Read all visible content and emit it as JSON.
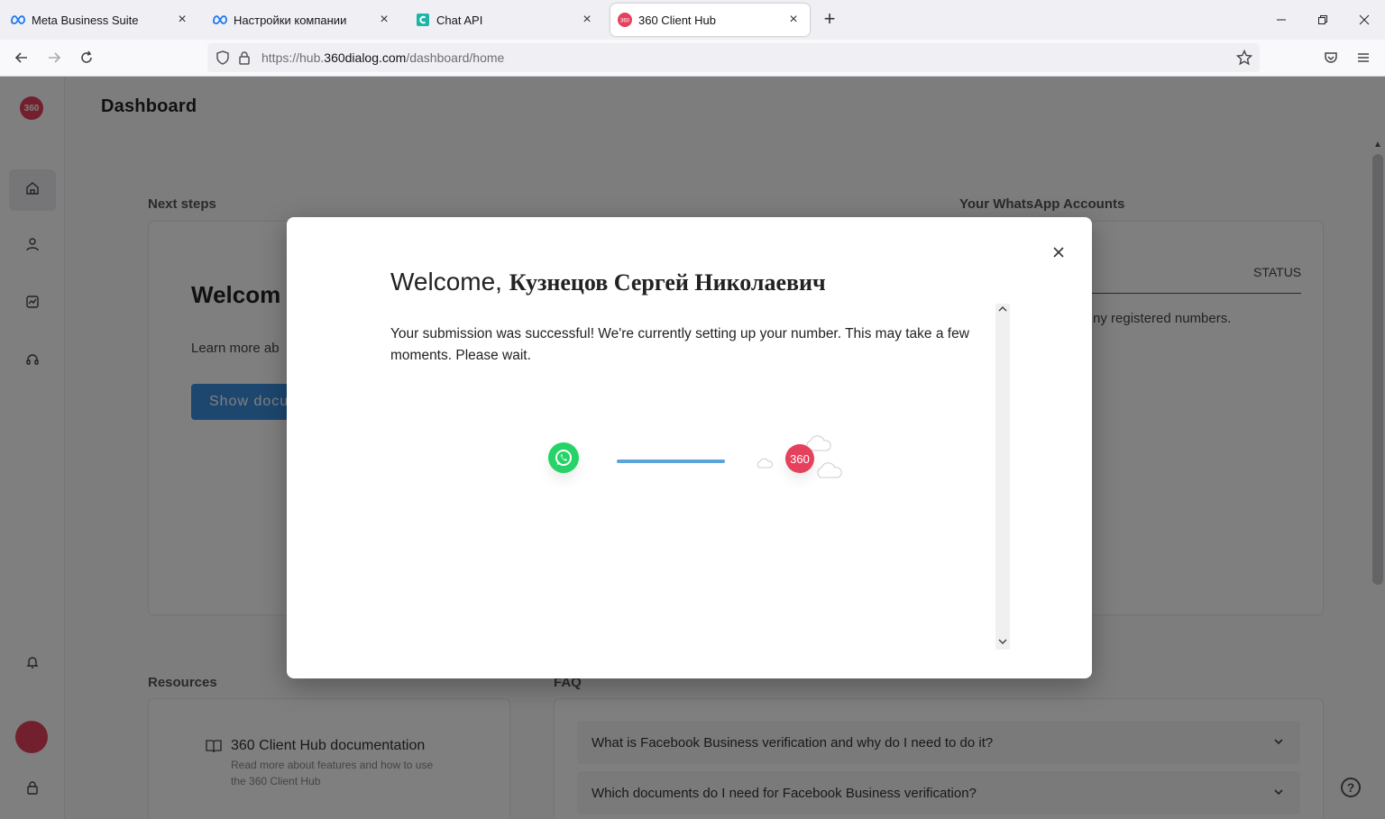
{
  "browser": {
    "tabs": [
      {
        "title": "Meta Business Suite",
        "icon": "meta-icon"
      },
      {
        "title": "Настройки компании",
        "icon": "meta-icon"
      },
      {
        "title": "Chat API",
        "icon": "chat-api-icon"
      },
      {
        "title": "360 Client Hub",
        "icon": "360-icon",
        "active": true
      }
    ],
    "url_prefix": "https://hub.",
    "url_domain": "360dialog.com",
    "url_path": "/dashboard/home"
  },
  "sidebar": {
    "logo_text": "360",
    "items": [
      "home-icon",
      "user-icon",
      "chart-icon",
      "headset-icon"
    ],
    "bottom": [
      "bell-icon",
      "avatar",
      "lock-icon"
    ]
  },
  "dashboard": {
    "title": "Dashboard",
    "next_steps_label": "Next steps",
    "whatsapp_accounts_label": "Your WhatsApp Accounts",
    "welcome_partial": "Welcom",
    "learn_partial": "Learn more ab",
    "show_button_partial": "Show docu",
    "status_header": "STATUS",
    "no_numbers_partial": "ny registered numbers.",
    "resources_label": "Resources",
    "faq_label": "FAQ",
    "resources": [
      {
        "title": "360 Client Hub documentation",
        "desc": "Read more about features and how to use the 360 Client Hub"
      }
    ],
    "faq": [
      "What is Facebook Business verification and why do I need to do it?",
      "Which documents do I need for Facebook Business verification?"
    ]
  },
  "modal": {
    "title_prefix": "Welcome, ",
    "title_name": "Кузнецов Сергей Николаевич",
    "body": "Your submission was successful! We're currently setting up your number. This may take a few moments. Please wait.",
    "progress": 1.0,
    "logo_text": "360"
  },
  "colors": {
    "brand": "#e5415d",
    "accent": "#3a8fde",
    "whatsapp": "#25d366"
  }
}
